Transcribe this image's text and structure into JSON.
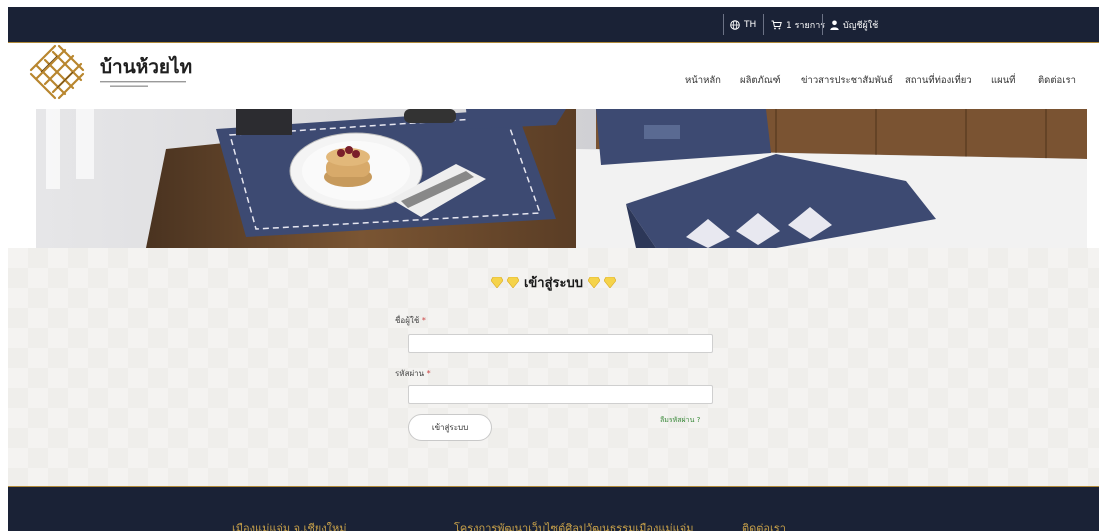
{
  "topbar": {
    "language": "TH",
    "cart": "1 รายการ",
    "account": "บัญชีผู้ใช้"
  },
  "header": {
    "brand_name": "บ้านห้วยไท",
    "nav": [
      "หน้าหลัก",
      "ผลิตภัณฑ์",
      "ข่าวสารประชาสัมพันธ์",
      "สถานที่ท่องเที่ยว",
      "แผนที่",
      "ติดต่อเรา"
    ]
  },
  "login": {
    "title": "เข้าสู่ระบบ",
    "username_label": "ชื่อผู้ใช้",
    "password_label": "รหัสผ่าน",
    "required_mark": "*",
    "submit_label": "เข้าสู่ระบบ",
    "forgot_label": "ลืมรหัสผ่าน ?"
  },
  "footer": {
    "col1": "เมืองแม่แจ่ม จ.เชียงใหม่",
    "col2": "โครงการพัฒนาเว็บไซต์ศิลปวัฒนธรรมเมืองแม่แจ่ม",
    "col3": "ติดต่อเรา"
  },
  "colors": {
    "navy": "#1a2236",
    "gold": "#b08a3a",
    "logo_gold": "#b8862e",
    "fabric_blue": "#3d4a72"
  },
  "icons": [
    "globe-icon",
    "cart-icon",
    "user-icon",
    "diamond-icon"
  ]
}
